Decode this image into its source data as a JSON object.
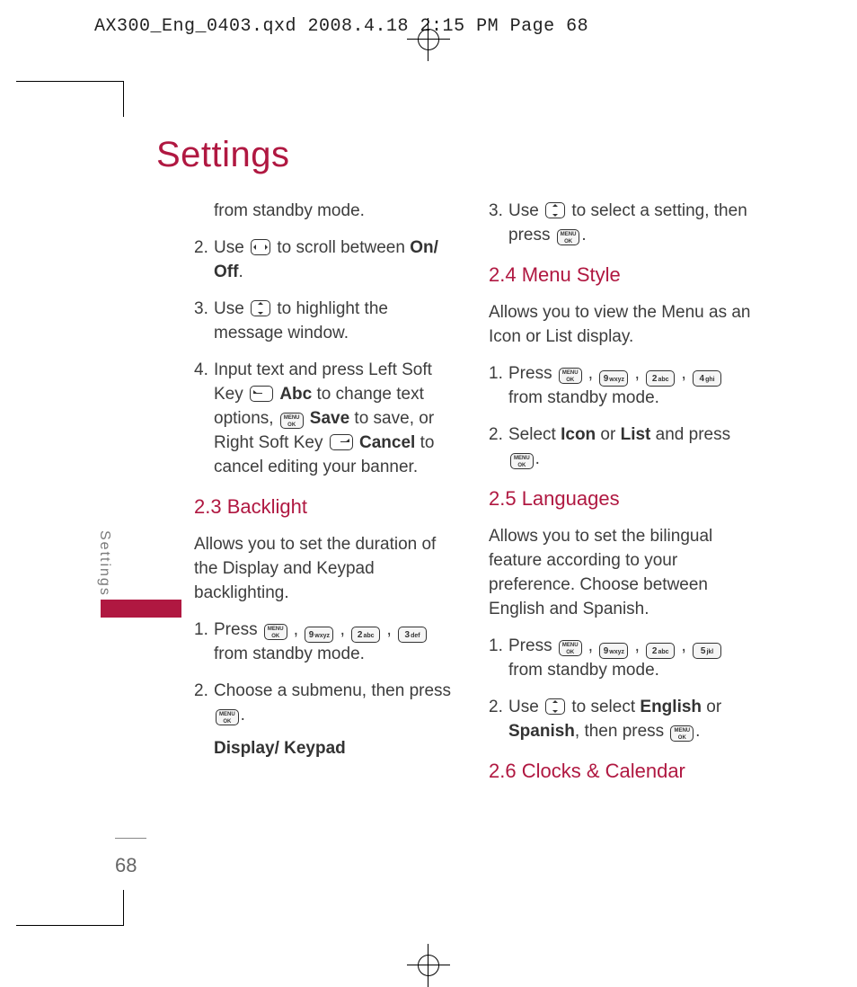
{
  "slug": "AX300_Eng_0403.qxd  2008.4.18  2:15 PM  Page 68",
  "title": "Settings",
  "side_tab": "Settings",
  "page_number": "68",
  "keys": {
    "ok_top": "MENU",
    "ok_bot": "OK",
    "k9": "9",
    "k9s": "wxyz",
    "k2": "2",
    "k2s": "abc",
    "k3": "3",
    "k3s": "def",
    "k4": "4",
    "k4s": "ghi",
    "k5": "5",
    "k5s": "jkl"
  },
  "left": {
    "p0": "from standby mode.",
    "s2a": "2.",
    "s2b_a": "Use ",
    "s2b_b": " to scroll between ",
    "onoff": "On/ Off",
    "s2b_c": ".",
    "s3a": "3.",
    "s3b_a": "Use ",
    "s3b_b": " to highlight the message window.",
    "s4a": "4.",
    "s4b_a": "Input text and press Left Soft Key ",
    "abc": "Abc",
    "s4b_b": " to change text options, ",
    "save": "Save",
    "s4b_c": " to save, or Right Soft Key ",
    "cancel": "Cancel",
    "s4b_d": " to cancel editing your banner.",
    "h23": "2.3 Backlight",
    "bl_intro": "Allows you to set the duration of the Display and Keypad backlighting.",
    "bl1a": "1.",
    "bl1b_a": "Press ",
    "bl1b_b": " from standby mode.",
    "bl2a": "2.",
    "bl2b_a": "Choose a submenu, then press ",
    "bl2b_b": ".",
    "bl_sub": "Display/ Keypad"
  },
  "right": {
    "r3a": "3.",
    "r3b_a": "Use ",
    "r3b_b": " to select a setting, then press ",
    "r3b_c": ".",
    "h24": "2.4 Menu Style",
    "ms_intro": "Allows you to view the Menu as an Icon or List display.",
    "ms1a": "1.",
    "ms1b_a": "Press ",
    "ms1b_b": " from standby mode.",
    "ms2a": "2.",
    "ms2b_a": "Select ",
    "icon": "Icon",
    "or1": " or ",
    "list": "List",
    "ms2b_b": " and press ",
    "ms2b_c": ".",
    "h25": "2.5 Languages",
    "lg_intro": "Allows you to set the bilingual feature according to your preference. Choose between English and Spanish.",
    "lg1a": "1.",
    "lg1b_a": "Press ",
    "lg1b_b": " from standby mode.",
    "lg2a": "2.",
    "lg2b_a": "Use ",
    "lg2b_b": " to select ",
    "eng": "English",
    "or2": " or ",
    "spa": "Spanish",
    "lg2b_c": ", then press ",
    "lg2b_d": ".",
    "h26": "2.6 Clocks & Calendar"
  }
}
